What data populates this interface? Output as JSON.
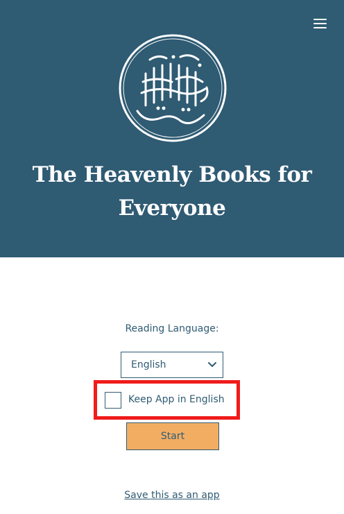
{
  "colors": {
    "header_bg": "#2f5b73",
    "accent_button": "#f2ad63",
    "highlight_box": "#f01b1b",
    "text": "#2f5b73"
  },
  "header": {
    "menu_icon": "hamburger-menu-icon",
    "logo_icon": "arabic-calligraphy-logo",
    "logo_text": "الكتب السماوية",
    "title": "The Heavenly Books for Everyone"
  },
  "main": {
    "language_label": "Reading Language:",
    "language_select": {
      "selected": "English",
      "icon": "chevron-down-icon"
    },
    "keep_english": {
      "label": "Keep App in English",
      "checked": false
    },
    "start_button": "Start",
    "save_link": "Save this as an app"
  }
}
